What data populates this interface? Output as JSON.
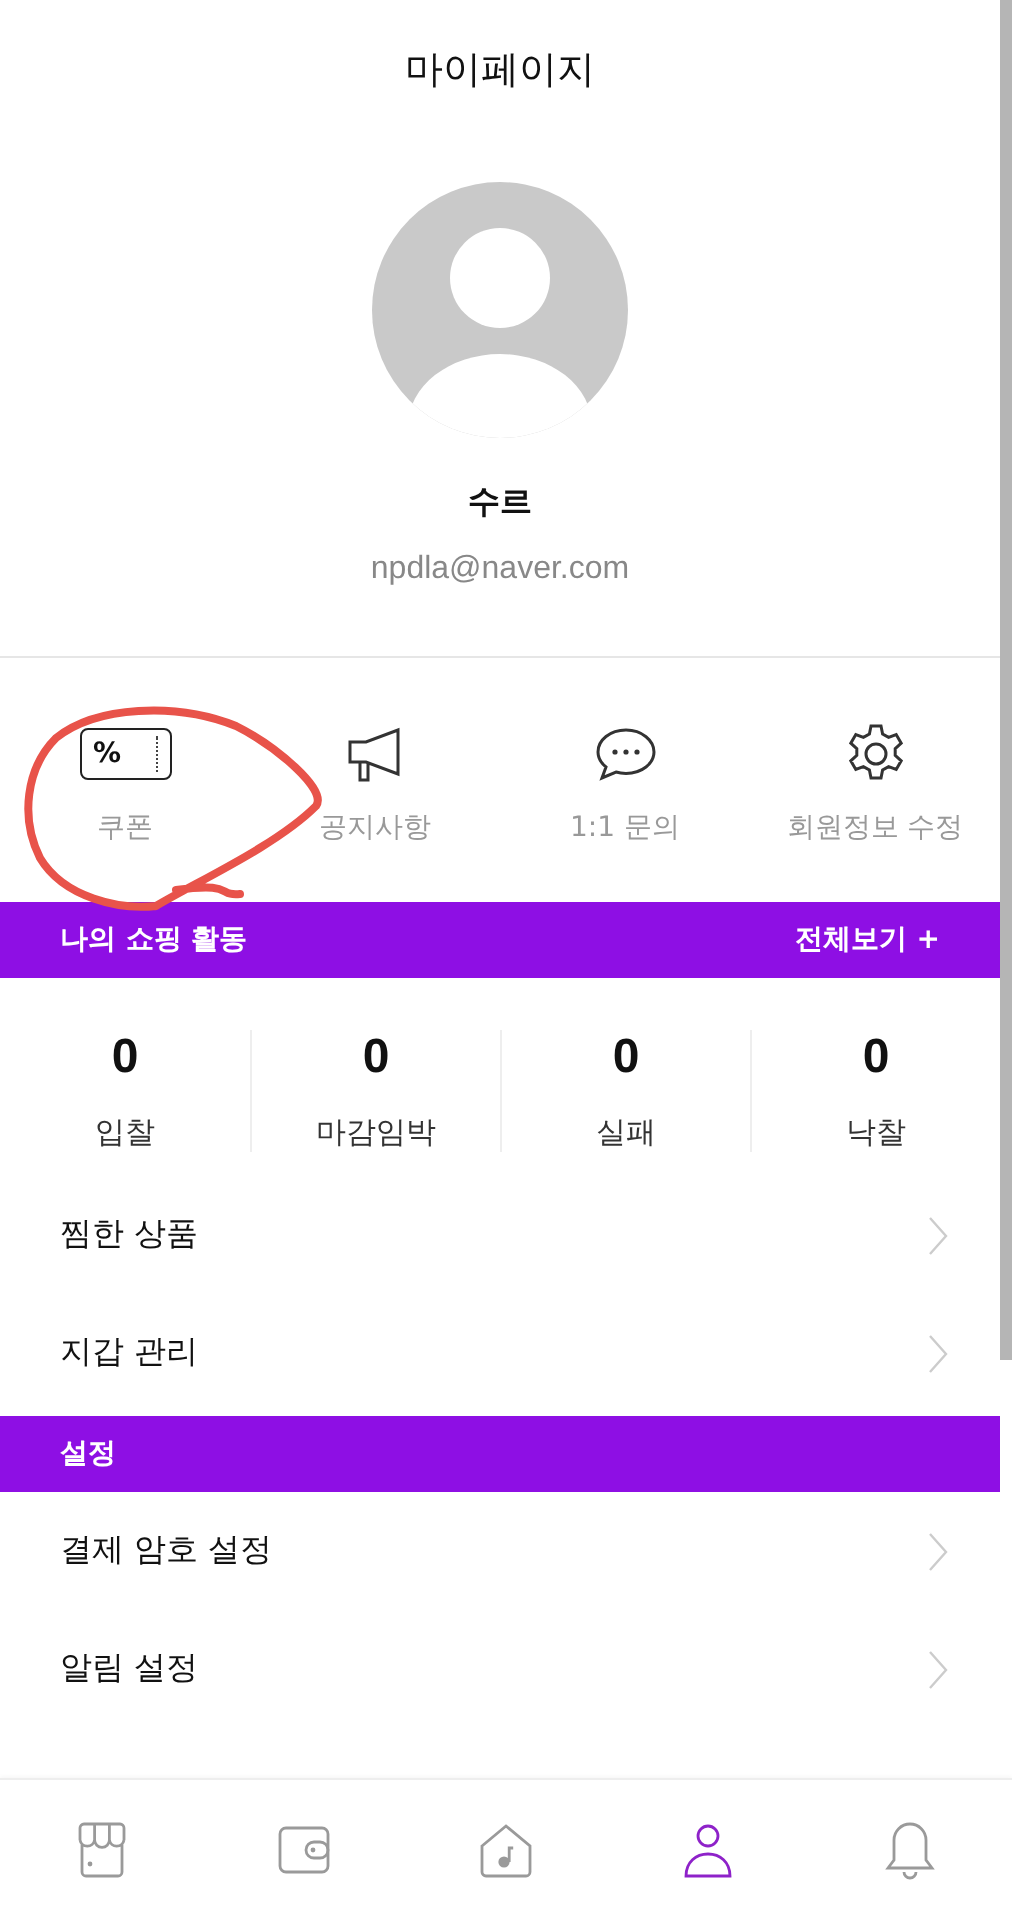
{
  "header": {
    "title": "마이페이지"
  },
  "profile": {
    "name": "수르",
    "email": "npdla@naver.com"
  },
  "quick_menu": [
    {
      "kind": "coupon",
      "label": "쿠폰",
      "icon_text": "%"
    },
    {
      "kind": "notice",
      "label": "공지사항"
    },
    {
      "kind": "inquiry",
      "label": "1:1 문의"
    },
    {
      "kind": "settings",
      "label": "회원정보 수정"
    }
  ],
  "activity": {
    "title": "나의 쇼핑 활동",
    "link": "전체보기 +",
    "stats": [
      {
        "value": "0",
        "label": "입찰"
      },
      {
        "value": "0",
        "label": "마감임박"
      },
      {
        "value": "0",
        "label": "실패"
      },
      {
        "value": "0",
        "label": "낙찰"
      }
    ]
  },
  "menu": [
    {
      "label": "찜한 상품"
    },
    {
      "label": "지갑 관리"
    }
  ],
  "settings": {
    "title": "설정",
    "items": [
      {
        "label": "결제 암호 설정"
      },
      {
        "label": "알림 설정"
      }
    ]
  },
  "bottom_nav": [
    {
      "kind": "shop",
      "selected": false
    },
    {
      "kind": "wallet",
      "selected": false
    },
    {
      "kind": "home",
      "selected": false
    },
    {
      "kind": "profile",
      "selected": true
    },
    {
      "kind": "bell",
      "selected": false
    }
  ]
}
